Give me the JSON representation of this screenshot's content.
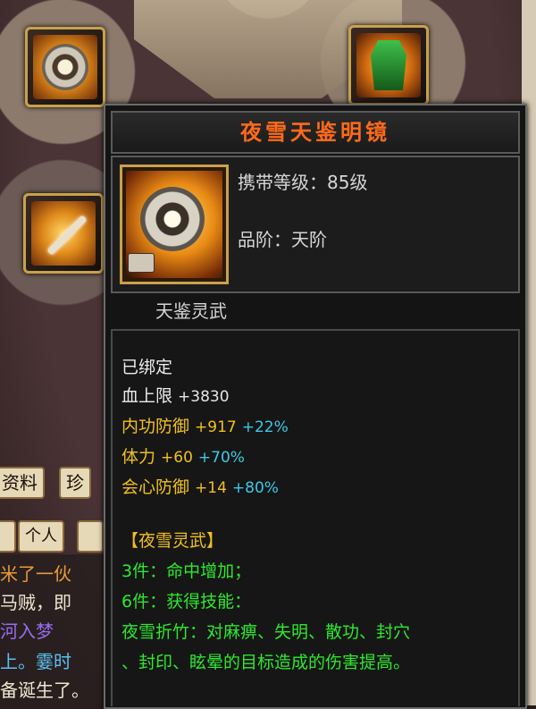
{
  "tooltip": {
    "item_name": "夜雪天鉴明镜",
    "carry_level": "携带等级：85级",
    "grade": "品阶：天阶",
    "category": "天鉴灵武",
    "bound": "已绑定",
    "stats": [
      {
        "name": "血上限",
        "value": "+3830",
        "pct": ""
      },
      {
        "name": "内功防御",
        "value": "+917",
        "pct": "+22%"
      },
      {
        "name": "体力",
        "value": "+60",
        "pct": "+70%"
      },
      {
        "name": "会心防御",
        "value": "+14",
        "pct": "+80%"
      }
    ],
    "set_name": "【夜雪灵武】",
    "set_bonus": [
      "3件：命中增加；",
      "6件：获得技能：",
      "夜雪折竹：对麻痹、失明、散功、封穴",
      "、封印、眩晕的目标造成的伤害提高。"
    ]
  },
  "background": {
    "tabs": [
      "资料",
      "珍"
    ],
    "chat_tab": "个人",
    "chat_lines": [
      "米了一伙",
      "马贼，即",
      "河入梦",
      "上。霎时",
      "备诞生了。"
    ],
    "colors": {
      "title": "#ff6a1a",
      "set": "#f0c020",
      "set_bonus": "#2ee82e",
      "percent": "#3ec8e8"
    }
  }
}
